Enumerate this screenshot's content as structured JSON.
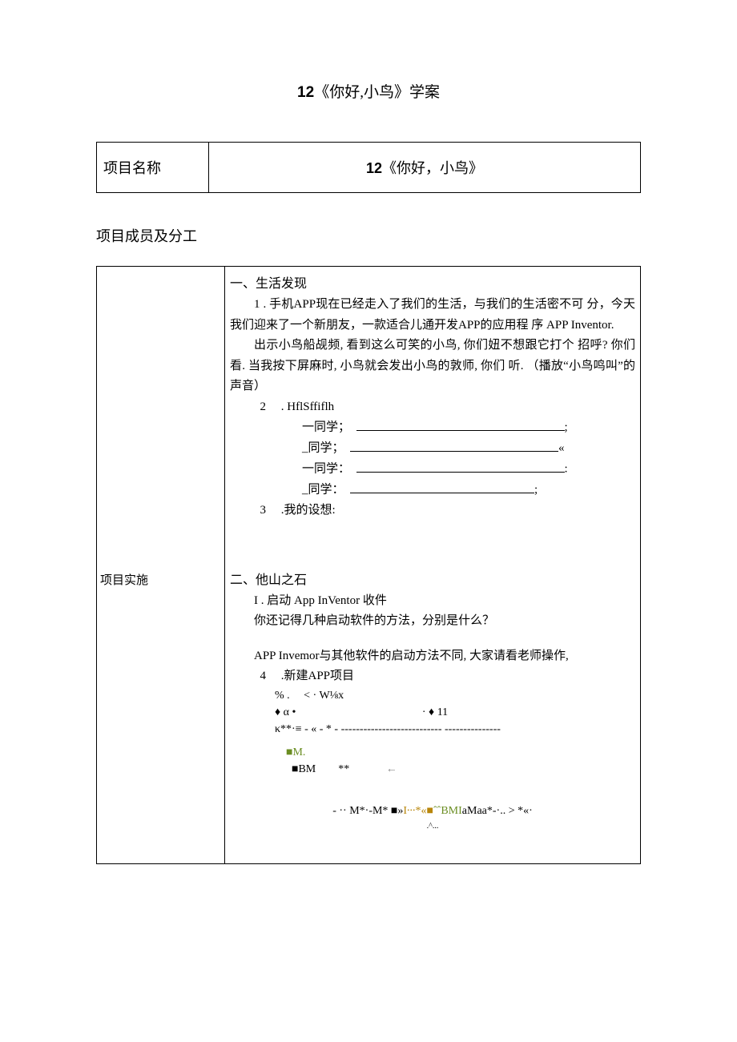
{
  "title_num": "12",
  "title_text": "《你好,小鸟》学案",
  "row1_label": "项目名称",
  "row1_value_num": "12",
  "row1_value_text": "《你好，小鸟》",
  "members_label": "项目成员及分工",
  "impl_label": "项目实施",
  "sec1_heading": "一、生活发现",
  "sec1_p1": "1 . 手机APP现在已经走入了我们的生活，与我们的生活密不可   分，今天我们迎来了一个新朋友，一款适合儿通开发APP的应用程   序   APP Inventor.",
  "sec1_p2": "出示小鸟船觇频, 看到这么可笑的小鸟, 你们妞不想跟它打个  招呼? 你们看. 当我按下屏麻时, 小鸟就会发出小鸟的敦师, 你们  听.  （播放“小鸟鸣叫”的声音）",
  "item2_num": "2",
  "item2_text": ". HflSffiflh",
  "stu1": "一同学；",
  "stu1_end": ";",
  "stu2": "_同学；",
  "stu2_end": "«",
  "stu3": "一同学：",
  "stu3_end": ":",
  "stu4": "_同学：",
  "stu4_end": ";",
  "item3_num": "3",
  "item3_text": ".我的设想:",
  "sec2_heading": "二、他山之石",
  "sec2_i1": "I . 启动  App InVentor 收件",
  "sec2_q1": "你还记得几种启动软件的方法，分别是什么？",
  "sec2_p1": "APP Invemor与其他软件的启动方法不同, 大家请看老师操作,",
  "item4_num": "4",
  "item4_text": ".新建APP项目",
  "g1": "% .     < · W⅛x",
  "g2a": "♦ α •",
  "g2b": "· ♦ 11",
  "g3": "κ**·≡ - « - * - --------------------------- ---------------",
  "g4": "■M.",
  "g5a": "■BM",
  "g5b": "**",
  "g5c": "←",
  "g6a": "- ·· M*·-M* ■»",
  "g6b": "I∙∙∙*«■",
  "g6c": "ˆˆBMI",
  "g6d": "aMaa*-·.. > *«·",
  "g6sub": ".^...",
  "bottom": ""
}
